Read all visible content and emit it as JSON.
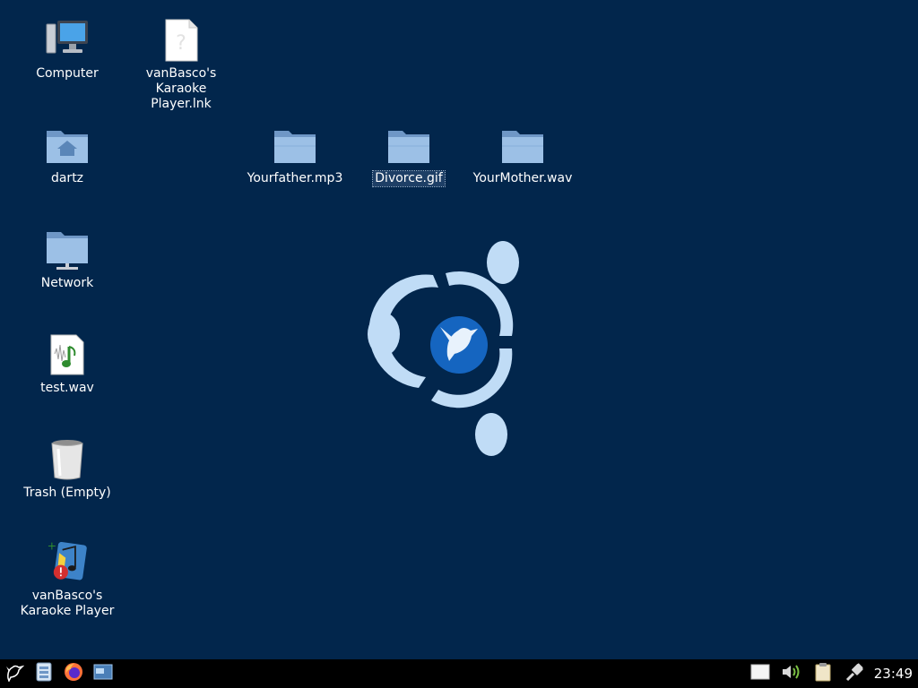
{
  "desktop": {
    "icons": [
      {
        "label": "Computer",
        "icon": "computer-icon"
      },
      {
        "label": "vanBasco's\nKaraoke\nPlayer.lnk",
        "icon": "unknown-file-icon"
      },
      {
        "label": "dartz",
        "icon": "home-folder-icon"
      },
      {
        "label": "Yourfather.mp3",
        "icon": "folder-icon"
      },
      {
        "label": "Divorce.gif",
        "icon": "folder-icon",
        "selected": true
      },
      {
        "label": "YourMother.wav",
        "icon": "folder-icon"
      },
      {
        "label": "Network",
        "icon": "network-folder-icon"
      },
      {
        "label": "test.wav",
        "icon": "audio-file-icon"
      },
      {
        "label": "Trash (Empty)",
        "icon": "trash-icon"
      },
      {
        "label": "vanBasco's\nKaraoke Player",
        "icon": "karaoke-app-icon"
      }
    ],
    "wallpaper": {
      "logo": "lubuntu-logo",
      "background_color": "#02264c",
      "logo_color": "#c0dcf6",
      "center_color": "#1565c0"
    }
  },
  "taskbar": {
    "launchers": [
      {
        "icon": "start-menu-icon"
      },
      {
        "icon": "file-manager-icon"
      },
      {
        "icon": "firefox-icon"
      },
      {
        "icon": "show-desktop-icon"
      }
    ],
    "tray": [
      {
        "icon": "notification-icon"
      },
      {
        "icon": "volume-icon"
      },
      {
        "icon": "clipboard-icon"
      },
      {
        "icon": "network-status-icon"
      }
    ],
    "clock": "23:49"
  }
}
